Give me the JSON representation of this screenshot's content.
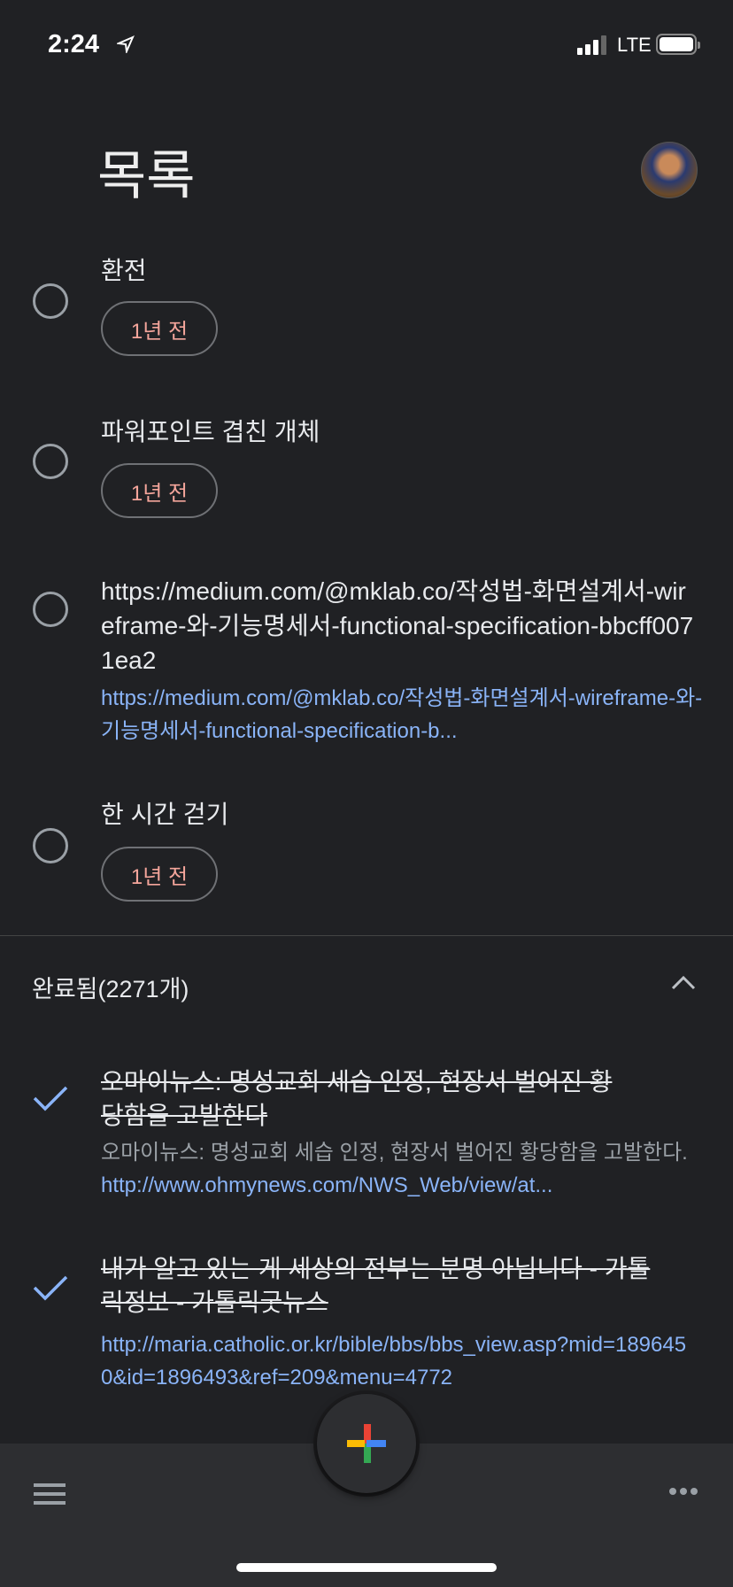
{
  "status_bar": {
    "time": "2:24",
    "network": "LTE"
  },
  "header": {
    "title": "목록"
  },
  "tasks": [
    {
      "title": "환전",
      "chip": "1년 전"
    },
    {
      "title": "파워포인트 겹친 개체",
      "chip": "1년 전"
    },
    {
      "title": "https://medium.com/@mklab.co/작성법-화면설계서-wireframe-와-기능명세서-functional-specification-bbcff0071ea2",
      "link": "https://medium.com/@mklab.co/작성법-화면설계서-wireframe-와-기능명세서-functional-specification-b..."
    },
    {
      "title": "한 시간 걷기",
      "chip": "1년 전"
    }
  ],
  "completed": {
    "header": "완료됨(2271개)",
    "items": [
      {
        "title": "오마이뉴스: 명성교회 세습 인정, 현장서 벌어진 황당함을 고발한다",
        "desc": "오마이뉴스: 명성교회 세습 인정, 현장서 벌어진 황당함을 고발한다.",
        "link": "http://www.ohmynews.com/NWS_Web/view/at..."
      },
      {
        "title": "내가 알고 있는 게 세상의 전부는 분명 아닙니다 - 가톨릭정보 - 가톨릭굿뉴스",
        "link": "http://maria.catholic.or.kr/bible/bbs/bbs_view.asp?mid=1896450&id=1896493&ref=209&menu=4772"
      }
    ]
  },
  "colors": {
    "background": "#202124",
    "link": "#8ab4f8",
    "chip_text": "#f4a59b",
    "bottom_bar": "#2d2e31"
  }
}
